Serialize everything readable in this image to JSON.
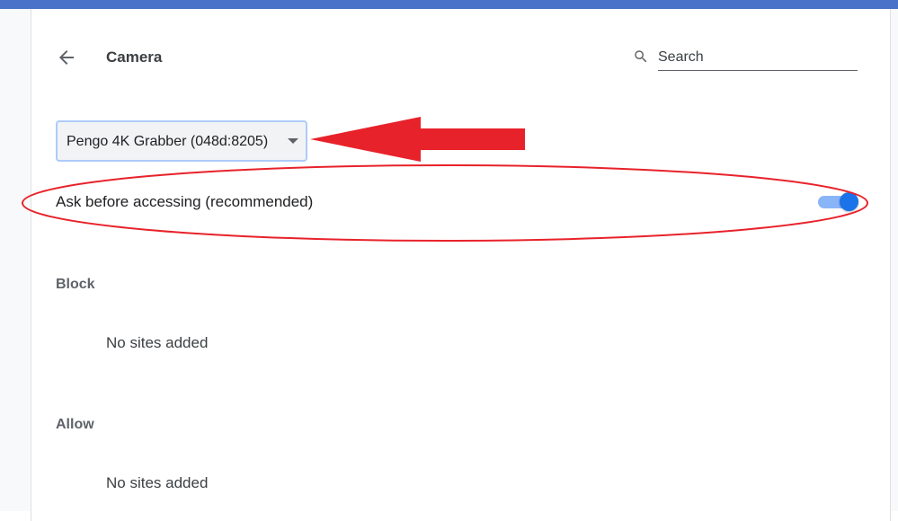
{
  "header": {
    "title": "Camera",
    "back_icon": "arrow-left-icon"
  },
  "search": {
    "placeholder": "Search",
    "value": "",
    "icon": "search-icon"
  },
  "device_select": {
    "selected": "Pengo 4K Grabber (048d:8205)"
  },
  "ask_setting": {
    "label": "Ask before accessing (recommended)",
    "enabled": true
  },
  "sections": {
    "block": {
      "heading": "Block",
      "empty_text": "No sites added"
    },
    "allow": {
      "heading": "Allow",
      "empty_text": "No sites added"
    }
  },
  "colors": {
    "top_bar": "#4a72c8",
    "toggle_on": "#1a73e8",
    "annotation_red": "#e8222a"
  },
  "annotations": {
    "arrow_icon": "red-arrow-icon",
    "ellipse_icon": "red-ellipse-highlight"
  }
}
